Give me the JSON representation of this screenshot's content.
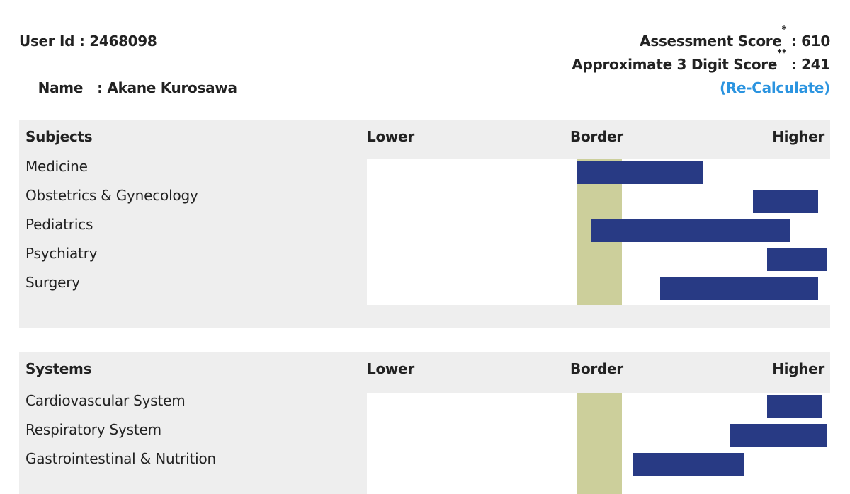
{
  "header": {
    "user_id_label": "User Id : ",
    "user_id": "2468098",
    "name_label": "Name   : ",
    "name": "Akane Kurosawa",
    "assessment_label": "Assessment Score",
    "assessment_mark": "*",
    "assessment_value": " : 610",
    "approx_label": "Approximate 3 Digit Score",
    "approx_mark": "**",
    "approx_value": " : 241",
    "recalculate_link": "(Re-Calculate)"
  },
  "colors": {
    "bar": "#283a84",
    "border_band": "#cccf9b",
    "panel_bg": "#eeeeee",
    "link": "#2b94e0"
  },
  "chart_data": [
    {
      "type": "bar",
      "orientation": "horizontal-range",
      "title": "Subjects",
      "scale_labels": [
        "Lower",
        "Border",
        "Higher"
      ],
      "scale_range": [
        0,
        1
      ],
      "border_band": [
        0.452,
        0.551
      ],
      "categories": [
        "Medicine",
        "Obstetrics & Gynecology",
        "Pediatrics",
        "Psychiatry",
        "Surgery"
      ],
      "ranges": [
        [
          0.453,
          0.725
        ],
        [
          0.833,
          0.974
        ],
        [
          0.483,
          0.913
        ],
        [
          0.864,
          0.992
        ],
        [
          0.633,
          0.974
        ]
      ]
    },
    {
      "type": "bar",
      "orientation": "horizontal-range",
      "title": "Systems",
      "scale_labels": [
        "Lower",
        "Border",
        "Higher"
      ],
      "scale_range": [
        0,
        1
      ],
      "border_band": [
        0.452,
        0.551
      ],
      "categories": [
        "Cardiovascular System",
        "Respiratory System",
        "Gastrointestinal & Nutrition"
      ],
      "ranges": [
        [
          0.864,
          0.983
        ],
        [
          0.783,
          0.992
        ],
        [
          0.573,
          0.813
        ]
      ]
    }
  ]
}
